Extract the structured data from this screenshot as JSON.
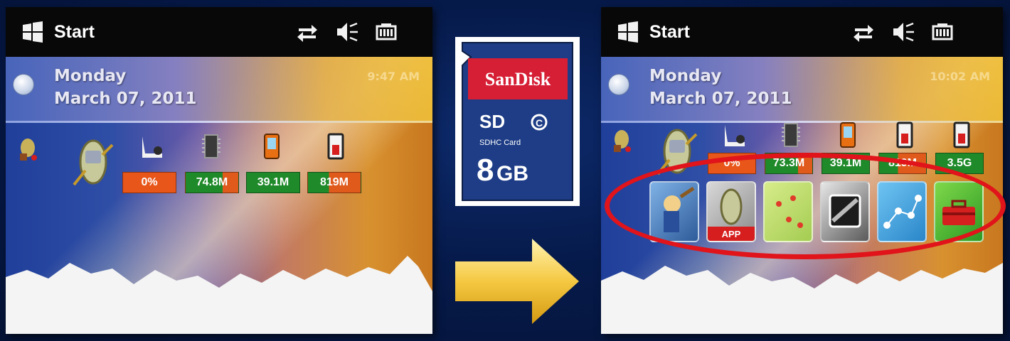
{
  "colors": {
    "background": "#061a4a",
    "taskbar": "#080808",
    "stat_orange": "#e8561a",
    "stat_green": "#1f8a2a",
    "highlight": "#e0141a",
    "sd_red": "#d61e35",
    "sd_blue": "#1e3d86",
    "arrow_yellow": "#f5c842"
  },
  "before_screen": {
    "start_label": "Start",
    "tray_icons": [
      "connectivity-icon",
      "volume-muted-icon",
      "battery-icon"
    ],
    "day": "Monday",
    "date": "March 07, 2011",
    "time": "9:47 AM",
    "stats": [
      "0%",
      "74.8M",
      "39.1M",
      "819M"
    ]
  },
  "sd_card": {
    "brand": "SanDisk",
    "logo_text": "SD",
    "type_label": "SDHC Card",
    "class_label": "C",
    "capacity_number": "8",
    "capacity_unit": "GB"
  },
  "after_screen": {
    "start_label": "Start",
    "tray_icons": [
      "connectivity-icon",
      "volume-muted-icon",
      "battery-icon"
    ],
    "day": "Monday",
    "date": "March 07, 2011",
    "time": "10:02 AM",
    "stats": [
      "0%",
      "73.3M",
      "39.1M",
      "819M",
      "3.5G"
    ],
    "app_tiles": [
      {
        "name": "tools-wizard-app-icon"
      },
      {
        "name": "device-app-icon",
        "badge": "APP"
      },
      {
        "name": "map-app-icon"
      },
      {
        "name": "memory-card-app-icon"
      },
      {
        "name": "network-nodes-app-icon"
      },
      {
        "name": "toolbox-app-icon"
      }
    ]
  }
}
